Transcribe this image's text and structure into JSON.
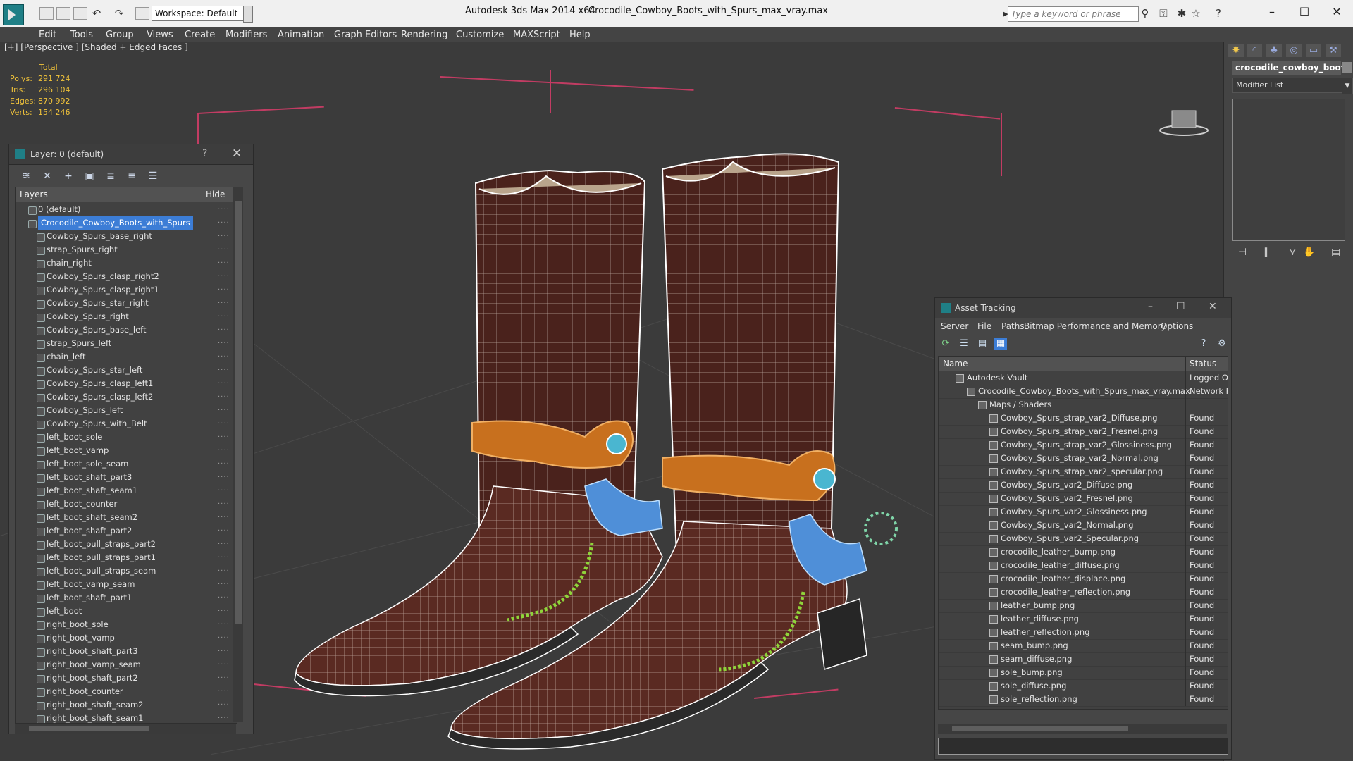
{
  "titlebar": {
    "workspace": "Workspace: Default",
    "app_title": "Autodesk 3ds Max  2014 x64",
    "file_title": "Crocodile_Cowboy_Boots_with_Spurs_max_vray.max",
    "search_placeholder": "Type a keyword or phrase"
  },
  "menu": [
    "Edit",
    "Tools",
    "Group",
    "Views",
    "Create",
    "Modifiers",
    "Animation",
    "Graph Editors",
    "Rendering",
    "Customize",
    "MAXScript",
    "Help"
  ],
  "viewport": {
    "label": "[+] [Perspective ] [Shaded + Edged Faces ]",
    "stats": {
      "total": "Total",
      "polys_label": "Polys:",
      "polys": "291 724",
      "tris_label": "Tris:",
      "tris": "296 104",
      "edges_label": "Edges:",
      "edges": "870 992",
      "verts_label": "Verts:",
      "verts": "154 246"
    }
  },
  "layer_panel": {
    "title": "Layer: 0 (default)",
    "help": "?",
    "close": "✕",
    "col_layers": "Layers",
    "col_hide": "Hide",
    "items": [
      "0 (default)",
      "Crocodile_Cowboy_Boots_with_Spurs",
      "Cowboy_Spurs_base_right",
      "strap_Spurs_right",
      "chain_right",
      "Cowboy_Spurs_clasp_right2",
      "Cowboy_Spurs_clasp_right1",
      "Cowboy_Spurs_star_right",
      "Cowboy_Spurs_right",
      "Cowboy_Spurs_base_left",
      "strap_Spurs_left",
      "chain_left",
      "Cowboy_Spurs_star_left",
      "Cowboy_Spurs_clasp_left1",
      "Cowboy_Spurs_clasp_left2",
      "Cowboy_Spurs_left",
      "Cowboy_Spurs_with_Belt",
      "left_boot_sole",
      "left_boot_vamp",
      "left_boot_sole_seam",
      "left_boot_shaft_part3",
      "left_boot_shaft_seam1",
      "left_boot_counter",
      "left_boot_shaft_seam2",
      "left_boot_shaft_part2",
      "left_boot_pull_straps_part2",
      "left_boot_pull_straps_part1",
      "left_boot_pull_straps_seam",
      "left_boot_vamp_seam",
      "left_boot_shaft_part1",
      "left_boot",
      "right_boot_sole",
      "right_boot_vamp",
      "right_boot_shaft_part3",
      "right_boot_vamp_seam",
      "right_boot_shaft_part2",
      "right_boot_counter",
      "right_boot_shaft_seam2",
      "right_boot_shaft_seam1"
    ]
  },
  "command_panel": {
    "object_name": "crocodile_cowboy_boots",
    "modifier_list": "Modifier List"
  },
  "asset_tracking": {
    "title": "Asset Tracking",
    "menu": [
      "Server",
      "File",
      "Paths",
      "Bitmap Performance and Memory",
      "Options"
    ],
    "col_name": "Name",
    "col_status": "Status",
    "rows": [
      {
        "name": "Autodesk Vault",
        "status": "Logged Ou"
      },
      {
        "name": "Crocodile_Cowboy_Boots_with_Spurs_max_vray.max",
        "status": "Network P"
      },
      {
        "name": "Maps / Shaders",
        "status": ""
      },
      {
        "name": "Cowboy_Spurs_strap_var2_Diffuse.png",
        "status": "Found"
      },
      {
        "name": "Cowboy_Spurs_strap_var2_Fresnel.png",
        "status": "Found"
      },
      {
        "name": "Cowboy_Spurs_strap_var2_Glossiness.png",
        "status": "Found"
      },
      {
        "name": "Cowboy_Spurs_strap_var2_Normal.png",
        "status": "Found"
      },
      {
        "name": "Cowboy_Spurs_strap_var2_specular.png",
        "status": "Found"
      },
      {
        "name": "Cowboy_Spurs_var2_Diffuse.png",
        "status": "Found"
      },
      {
        "name": "Cowboy_Spurs_var2_Fresnel.png",
        "status": "Found"
      },
      {
        "name": "Cowboy_Spurs_var2_Glossiness.png",
        "status": "Found"
      },
      {
        "name": "Cowboy_Spurs_var2_Normal.png",
        "status": "Found"
      },
      {
        "name": "Cowboy_Spurs_var2_Specular.png",
        "status": "Found"
      },
      {
        "name": "crocodile_leather_bump.png",
        "status": "Found"
      },
      {
        "name": "crocodile_leather_diffuse.png",
        "status": "Found"
      },
      {
        "name": "crocodile_leather_displace.png",
        "status": "Found"
      },
      {
        "name": "crocodile_leather_reflection.png",
        "status": "Found"
      },
      {
        "name": "leather_bump.png",
        "status": "Found"
      },
      {
        "name": "leather_diffuse.png",
        "status": "Found"
      },
      {
        "name": "leather_reflection.png",
        "status": "Found"
      },
      {
        "name": "seam_bump.png",
        "status": "Found"
      },
      {
        "name": "seam_diffuse.png",
        "status": "Found"
      },
      {
        "name": "sole_bump.png",
        "status": "Found"
      },
      {
        "name": "sole_diffuse.png",
        "status": "Found"
      },
      {
        "name": "sole_reflection.png",
        "status": "Found"
      }
    ]
  },
  "colors": {
    "viewport_bg": "#3b3b3b",
    "stats_text": "#f0c23a",
    "selection": "#3c7dd6",
    "boot_leather": "#5a2a22",
    "spur_strap": "#c8701e",
    "spur_metal": "#4f8fd8",
    "bounding_box": "#c23c63"
  }
}
